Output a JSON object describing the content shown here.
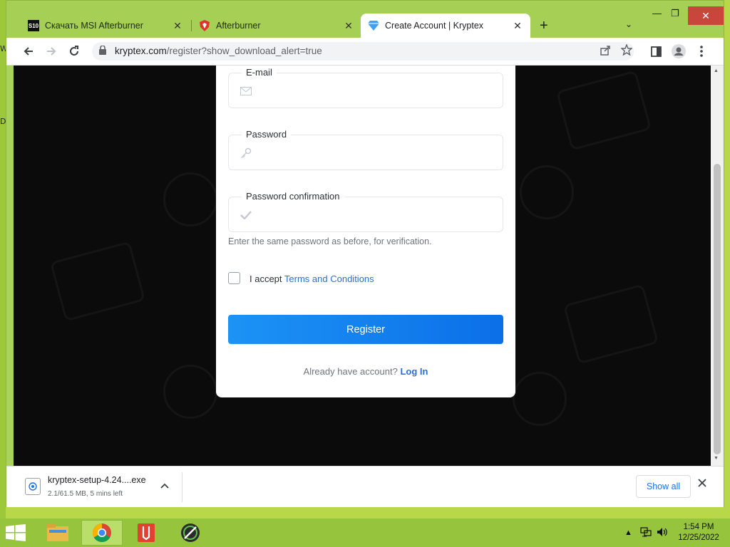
{
  "desktop": {
    "edge_letters": [
      "W",
      "D"
    ]
  },
  "browser": {
    "tabs": [
      {
        "favicon": "S10",
        "label": "Скачать MSI Afterburner",
        "close": "✕"
      },
      {
        "favicon": "shield",
        "label": "Afterburner",
        "close": "✕"
      },
      {
        "favicon": "diamond",
        "label": "Create Account | Kryptex",
        "close": "✕",
        "active": true
      }
    ],
    "new_tab": "+",
    "tab_list": "⌄",
    "window_controls": {
      "minimize": "—",
      "maximize": "❐",
      "close": "✕"
    },
    "url": {
      "host": "kryptex.com",
      "path": "/register?show_download_alert=true"
    }
  },
  "form": {
    "email": {
      "label": "E-mail",
      "icon": "envelope-icon"
    },
    "password": {
      "label": "Password",
      "icon": "key-icon"
    },
    "password_confirmation": {
      "label": "Password confirmation",
      "icon": "check-icon"
    },
    "hint": "Enter the same password as before, for verification.",
    "accept_prefix": "I accept",
    "terms_link": "Terms and Conditions",
    "register_button": "Register",
    "already_text": "Already have account?",
    "login_link": "Log In"
  },
  "downloads": {
    "file_name": "kryptex-setup-4.24....exe",
    "status": "2.1/61.5 MB, 5 mins left",
    "show_all": "Show all"
  },
  "taskbar": {
    "time": "1:54 PM",
    "date": "12/25/2022"
  },
  "colors": {
    "accent": "#1a73e8",
    "register_gradient_start": "#1c93f5",
    "register_gradient_end": "#0c6fe8",
    "page_background": "#0b0b0c",
    "theme_green": "#a6cf55"
  }
}
